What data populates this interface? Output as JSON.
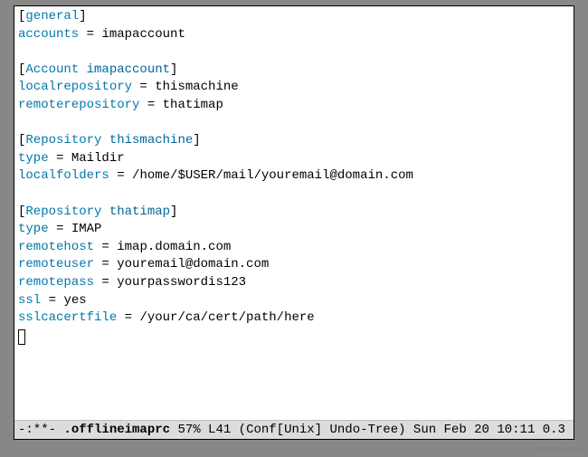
{
  "sections": [
    {
      "name": "general",
      "arg": "",
      "entries": [
        {
          "key": "accounts",
          "val": "imapaccount"
        }
      ]
    },
    {
      "name": "Account",
      "arg": "imapaccount",
      "entries": [
        {
          "key": "localrepository",
          "val": "thismachine"
        },
        {
          "key": "remoterepository",
          "val": "thatimap"
        }
      ]
    },
    {
      "name": "Repository",
      "arg": "thismachine",
      "entries": [
        {
          "key": "type",
          "val": "Maildir"
        },
        {
          "key": "localfolders",
          "val": "/home/$USER/mail/youremail@domain.com"
        }
      ]
    },
    {
      "name": "Repository",
      "arg": "thatimap",
      "entries": [
        {
          "key": "type",
          "val": "IMAP"
        },
        {
          "key": "remotehost",
          "val": "imap.domain.com"
        },
        {
          "key": "remoteuser",
          "val": "youremail@domain.com"
        },
        {
          "key": "remotepass",
          "val": "yourpasswordis123"
        },
        {
          "key": "ssl",
          "val": "yes"
        },
        {
          "key": "sslcacertfile",
          "val": "/your/ca/cert/path/here"
        }
      ]
    }
  ],
  "modeline": {
    "prefix": "-:**-",
    "filename": ".offlineimaprc",
    "position": "57% L41",
    "mode": "(Conf[Unix] Undo-Tree)",
    "datetime": "Sun Feb 20 10:11 0.3"
  },
  "watermark": "wsxdn.com"
}
